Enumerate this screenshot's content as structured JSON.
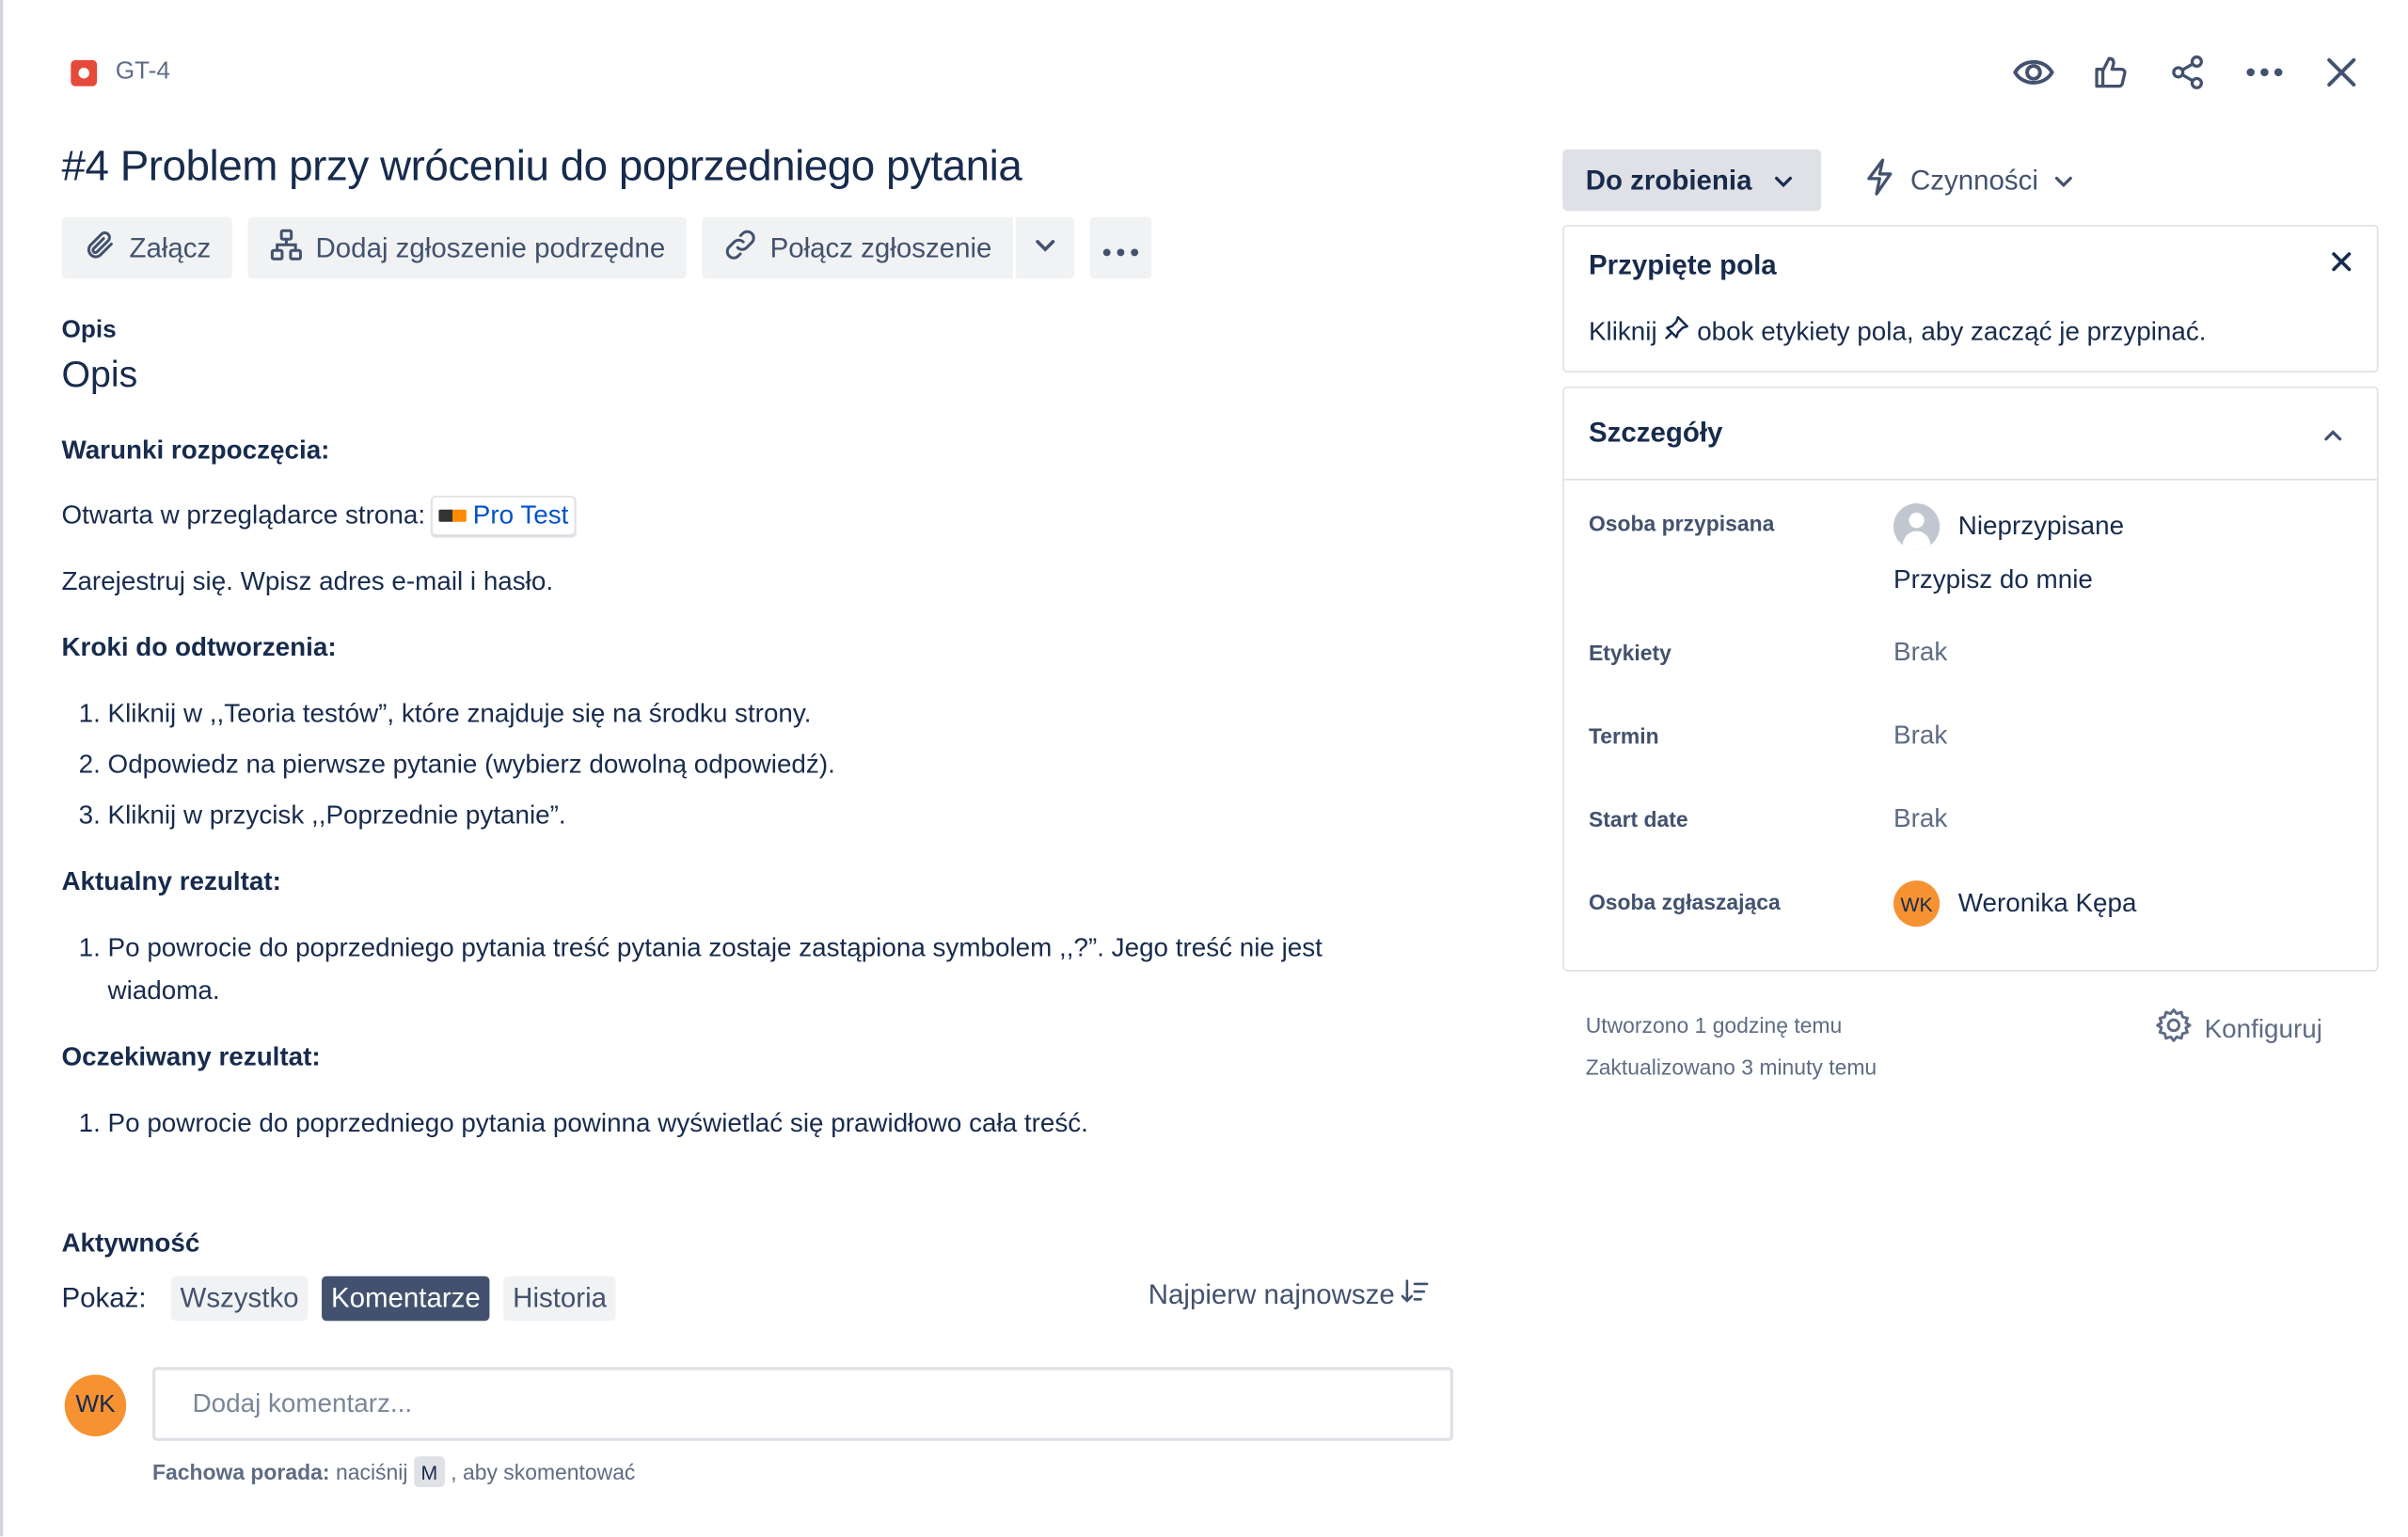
{
  "header": {
    "issue_key": "GT-4",
    "title": "#4 Problem przy wróceniu do poprzedniego pytania",
    "top_icons": [
      "eye-icon",
      "thumbs-up-icon",
      "share-icon",
      "more-icon",
      "close-icon"
    ]
  },
  "actions": {
    "attach": "Załącz",
    "add_child": "Dodaj zgłoszenie podrzędne",
    "link_issue": "Połącz zgłoszenie"
  },
  "description": {
    "label": "Opis",
    "heading": "Opis",
    "preconditions_title": "Warunki rozpoczęcia:",
    "open_page_text": "Otwarta w przeglądarce strona:",
    "pro_test_link": "Pro Test",
    "register_text": "Zarejestruj się. Wpisz adres e-mail i hasło.",
    "steps_title": "Kroki do odtworzenia:",
    "steps": [
      "Kliknij w ,,Teoria testów”, które znajduje się na środku strony.",
      "Odpowiedz na pierwsze pytanie (wybierz dowolną odpowiedź).",
      "Kliknij w przycisk ,,Poprzednie pytanie”."
    ],
    "actual_title": "Aktualny rezultat:",
    "actual": [
      "Po powrocie do poprzedniego pytania treść pytania zostaje zastąpiona symbolem ,,?”. Jego treść nie jest wiadoma."
    ],
    "expected_title": "Oczekiwany rezultat:",
    "expected": [
      "Po powrocie do poprzedniego pytania powinna wyświetlać się prawidłowo cała treść."
    ]
  },
  "activity": {
    "title": "Aktywność",
    "show_label": "Pokaż:",
    "filters": [
      "Wszystko",
      "Komentarze",
      "Historia"
    ],
    "active_filter": "Komentarze",
    "sort_label": "Najpierw najnowsze",
    "comment_avatar": "WK",
    "comment_placeholder": "Dodaj komentarz...",
    "tip_bold": "Fachowa porada:",
    "tip_pre": "naciśnij",
    "tip_key": "M",
    "tip_post": ", aby skomentować"
  },
  "side": {
    "status": "Do zrobienia",
    "actions_label": "Czynności",
    "pinned": {
      "title": "Przypięte pola",
      "text_pre": "Kliknij",
      "text_post": "obok etykiety pola, aby zacząć je przypinać."
    },
    "details": {
      "title": "Szczegóły",
      "assignee_label": "Osoba przypisana",
      "assignee_value": "Nieprzypisane",
      "assign_to_me": "Przypisz do mnie",
      "labels_label": "Etykiety",
      "labels_value": "Brak",
      "due_label": "Termin",
      "due_value": "Brak",
      "start_label": "Start date",
      "start_value": "Brak",
      "reporter_label": "Osoba zgłaszająca",
      "reporter_initials": "WK",
      "reporter_value": "Weronika Kępa"
    },
    "created": "Utworzono 1 godzinę temu",
    "updated": "Zaktualizowano 3 minuty temu",
    "configure": "Konfiguruj"
  },
  "colors": {
    "bug": "#e5493a",
    "link": "#0052cc",
    "avatar": "#f79232",
    "active_chip": "#42526e"
  }
}
